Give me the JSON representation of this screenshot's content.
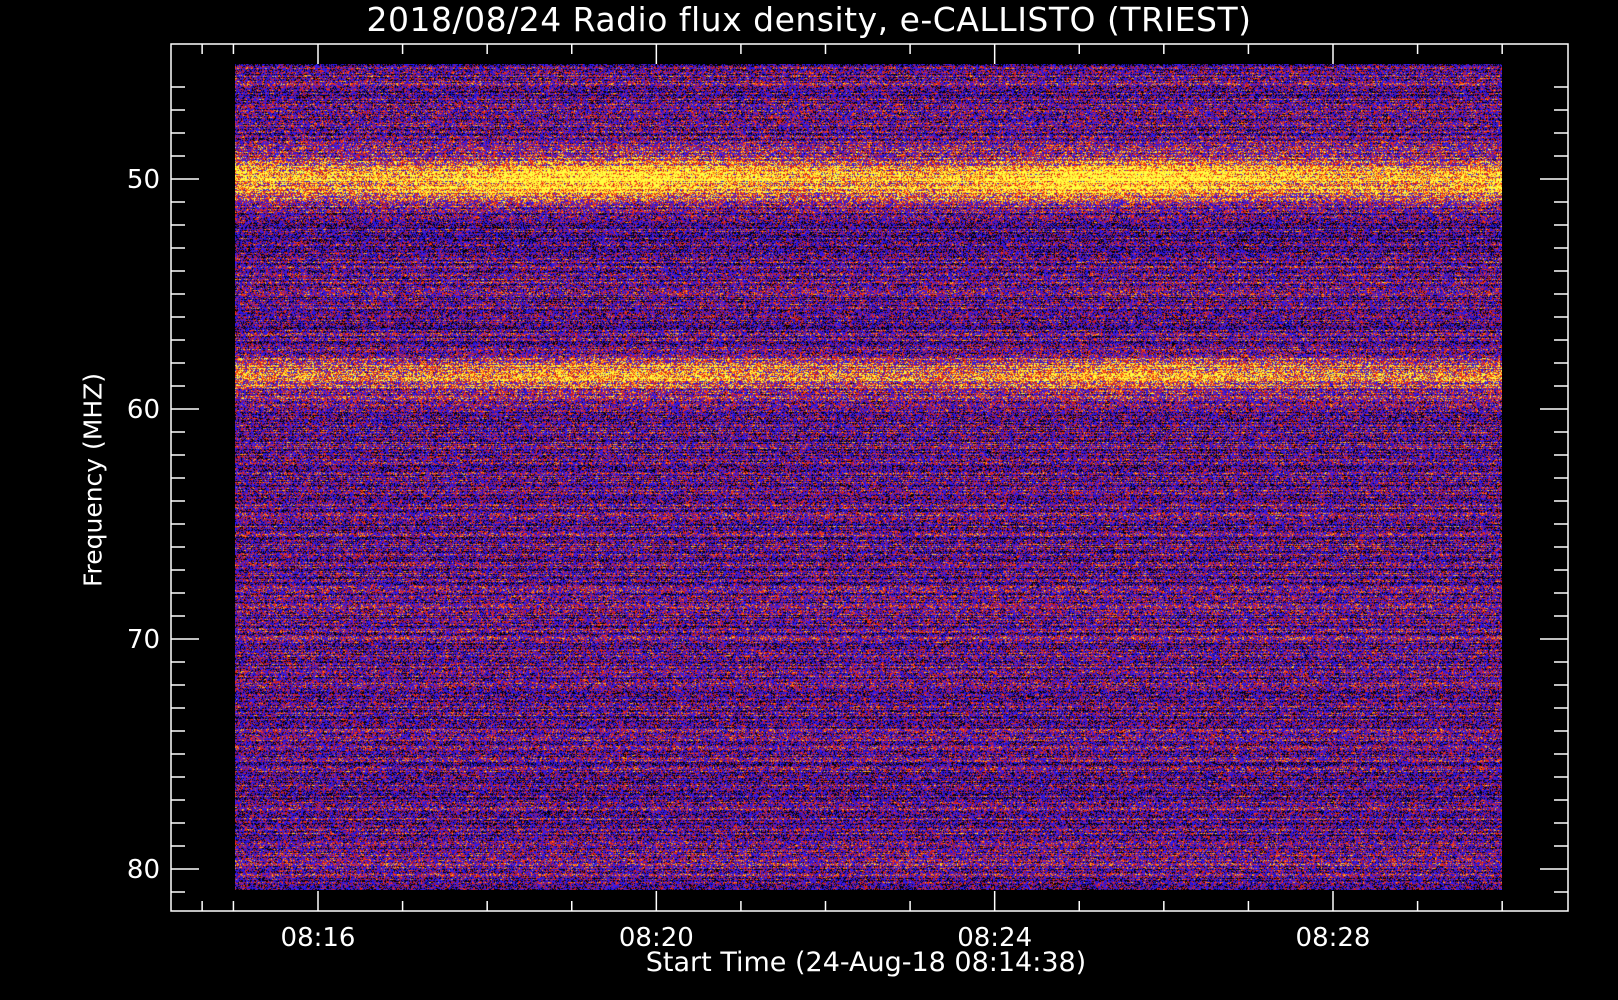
{
  "chart_data": {
    "type": "heatmap",
    "title": "2018/08/24  Radio flux density, e-CALLISTO (TRIEST)",
    "xlabel": "Start Time (24-Aug-18 08:14:38)",
    "ylabel": "Frequency (MHZ)",
    "x_ticks": [
      "08:16",
      "08:20",
      "08:24",
      "08:28"
    ],
    "x_tick_minutes": [
      16,
      20,
      24,
      28
    ],
    "x_range_minutes": [
      14.63,
      30.0
    ],
    "y_ticks": [
      50,
      60,
      70,
      80
    ],
    "y_range": [
      45,
      81
    ],
    "y_reversed": true,
    "colormap": [
      "#000000",
      "#1f12c8",
      "#2a1aff",
      "#5a1cc0",
      "#c81a20",
      "#ff3a10",
      "#ffb020",
      "#ffff40"
    ],
    "features": [
      {
        "name": "",
        "freq_mhz": 50.0,
        "intensity": "high"
      },
      {
        "name": "",
        "freq_mhz": 58.5,
        "intensity": "medium"
      }
    ]
  }
}
